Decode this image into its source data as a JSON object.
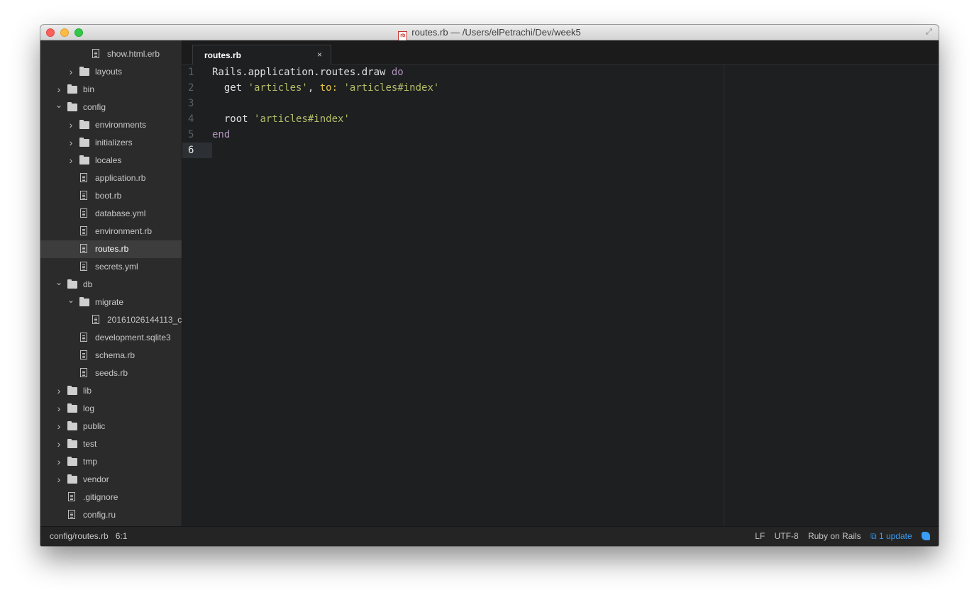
{
  "window": {
    "title": "routes.rb — /Users/elPetrachi/Dev/week5",
    "title_icon": "rb"
  },
  "sidebar": {
    "items": [
      {
        "label": "show.html.erb",
        "kind": "file",
        "depth": 3,
        "expanded": null,
        "selected": false
      },
      {
        "label": "layouts",
        "kind": "folder",
        "depth": 2,
        "expanded": false,
        "selected": false
      },
      {
        "label": "bin",
        "kind": "folder",
        "depth": 1,
        "expanded": false,
        "selected": false
      },
      {
        "label": "config",
        "kind": "folder",
        "depth": 1,
        "expanded": true,
        "selected": false
      },
      {
        "label": "environments",
        "kind": "folder",
        "depth": 2,
        "expanded": false,
        "selected": false
      },
      {
        "label": "initializers",
        "kind": "folder",
        "depth": 2,
        "expanded": false,
        "selected": false
      },
      {
        "label": "locales",
        "kind": "folder",
        "depth": 2,
        "expanded": false,
        "selected": false
      },
      {
        "label": "application.rb",
        "kind": "file",
        "depth": 2,
        "expanded": null,
        "selected": false
      },
      {
        "label": "boot.rb",
        "kind": "file",
        "depth": 2,
        "expanded": null,
        "selected": false
      },
      {
        "label": "database.yml",
        "kind": "file",
        "depth": 2,
        "expanded": null,
        "selected": false
      },
      {
        "label": "environment.rb",
        "kind": "file",
        "depth": 2,
        "expanded": null,
        "selected": false
      },
      {
        "label": "routes.rb",
        "kind": "file",
        "depth": 2,
        "expanded": null,
        "selected": true
      },
      {
        "label": "secrets.yml",
        "kind": "file",
        "depth": 2,
        "expanded": null,
        "selected": false
      },
      {
        "label": "db",
        "kind": "folder",
        "depth": 1,
        "expanded": true,
        "selected": false
      },
      {
        "label": "migrate",
        "kind": "folder",
        "depth": 2,
        "expanded": true,
        "selected": false
      },
      {
        "label": "20161026144113_c",
        "kind": "file",
        "depth": 3,
        "expanded": null,
        "selected": false
      },
      {
        "label": "development.sqlite3",
        "kind": "file",
        "depth": 2,
        "expanded": null,
        "selected": false
      },
      {
        "label": "schema.rb",
        "kind": "file",
        "depth": 2,
        "expanded": null,
        "selected": false
      },
      {
        "label": "seeds.rb",
        "kind": "file",
        "depth": 2,
        "expanded": null,
        "selected": false
      },
      {
        "label": "lib",
        "kind": "folder",
        "depth": 1,
        "expanded": false,
        "selected": false
      },
      {
        "label": "log",
        "kind": "folder",
        "depth": 1,
        "expanded": false,
        "selected": false
      },
      {
        "label": "public",
        "kind": "folder",
        "depth": 1,
        "expanded": false,
        "selected": false
      },
      {
        "label": "test",
        "kind": "folder",
        "depth": 1,
        "expanded": false,
        "selected": false
      },
      {
        "label": "tmp",
        "kind": "folder",
        "depth": 1,
        "expanded": false,
        "selected": false
      },
      {
        "label": "vendor",
        "kind": "folder",
        "depth": 1,
        "expanded": false,
        "selected": false
      },
      {
        "label": ".gitignore",
        "kind": "file",
        "depth": 1,
        "expanded": null,
        "selected": false
      },
      {
        "label": "config.ru",
        "kind": "file",
        "depth": 1,
        "expanded": null,
        "selected": false
      }
    ]
  },
  "tabs": [
    {
      "label": "routes.rb",
      "close": "×"
    }
  ],
  "editor": {
    "active_line": 6,
    "lines": [
      {
        "number": "1",
        "tokens": [
          {
            "text": "Rails.application.routes.draw ",
            "cls": ""
          },
          {
            "text": "do",
            "cls": "kw"
          }
        ]
      },
      {
        "number": "2",
        "tokens": [
          {
            "text": "  get ",
            "cls": ""
          },
          {
            "text": "'articles'",
            "cls": "str"
          },
          {
            "text": ", ",
            "cls": ""
          },
          {
            "text": "to:",
            "cls": "sym"
          },
          {
            "text": " ",
            "cls": ""
          },
          {
            "text": "'articles#index'",
            "cls": "str"
          }
        ]
      },
      {
        "number": "3",
        "tokens": []
      },
      {
        "number": "4",
        "tokens": [
          {
            "text": "  root ",
            "cls": ""
          },
          {
            "text": "'articles#index'",
            "cls": "str"
          }
        ]
      },
      {
        "number": "5",
        "tokens": [
          {
            "text": "end",
            "cls": "kw"
          }
        ]
      },
      {
        "number": "6",
        "tokens": []
      }
    ]
  },
  "statusbar": {
    "path": "config/routes.rb",
    "cursor": "6:1",
    "line_ending": "LF",
    "encoding": "UTF-8",
    "grammar": "Ruby on Rails",
    "update": "1 update"
  },
  "colors": {
    "keyword": "#b294bb",
    "string": "#b5bd68",
    "symbol": "#e6c547",
    "update_link": "#3a9cf3"
  }
}
